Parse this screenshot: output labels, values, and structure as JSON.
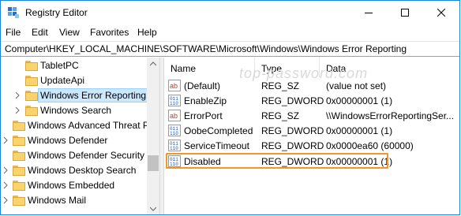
{
  "window": {
    "title": "Registry Editor",
    "accent": "#1883d7"
  },
  "menu": [
    "File",
    "Edit",
    "View",
    "Favorites",
    "Help"
  ],
  "address": "Computer\\HKEY_LOCAL_MACHINE\\SOFTWARE\\Microsoft\\Windows\\Windows Error Reporting",
  "tree": [
    {
      "label": "TabletPC",
      "chevron": false
    },
    {
      "label": "UpdateApi",
      "chevron": false
    },
    {
      "label": "Windows Error Reporting",
      "chevron": true,
      "selected": true
    },
    {
      "label": "Windows Search",
      "chevron": true
    },
    {
      "label": "Windows Advanced Threat P",
      "chevron": false
    },
    {
      "label": "Windows Defender",
      "chevron": true
    },
    {
      "label": "Windows Defender Security C",
      "chevron": false
    },
    {
      "label": "Windows Desktop Search",
      "chevron": true
    },
    {
      "label": "Windows Embedded",
      "chevron": true
    },
    {
      "label": "Windows Mail",
      "chevron": true
    }
  ],
  "list": {
    "columns": [
      "Name",
      "Type",
      "Data"
    ],
    "rows": [
      {
        "name": "(Default)",
        "type": "REG_SZ",
        "data": "(value not set)",
        "icon": "string-value-icon"
      },
      {
        "name": "EnableZip",
        "type": "REG_DWORD",
        "data": "0x00000001 (1)",
        "icon": "binary-value-icon"
      },
      {
        "name": "ErrorPort",
        "type": "REG_SZ",
        "data": "\\\\WindowsErrorReportingSer...",
        "icon": "string-value-icon"
      },
      {
        "name": "OobeCompleted",
        "type": "REG_DWORD",
        "data": "0x00000001 (1)",
        "icon": "binary-value-icon"
      },
      {
        "name": "ServiceTimeout",
        "type": "REG_DWORD",
        "data": "0x0000ea60 (60000)",
        "icon": "binary-value-icon"
      },
      {
        "name": "Disabled",
        "type": "REG_DWORD",
        "data": "0x00000001 (1)",
        "icon": "binary-value-icon",
        "selected": true
      }
    ]
  },
  "watermark": "top-password.com",
  "highlight_color": "#f5942a"
}
